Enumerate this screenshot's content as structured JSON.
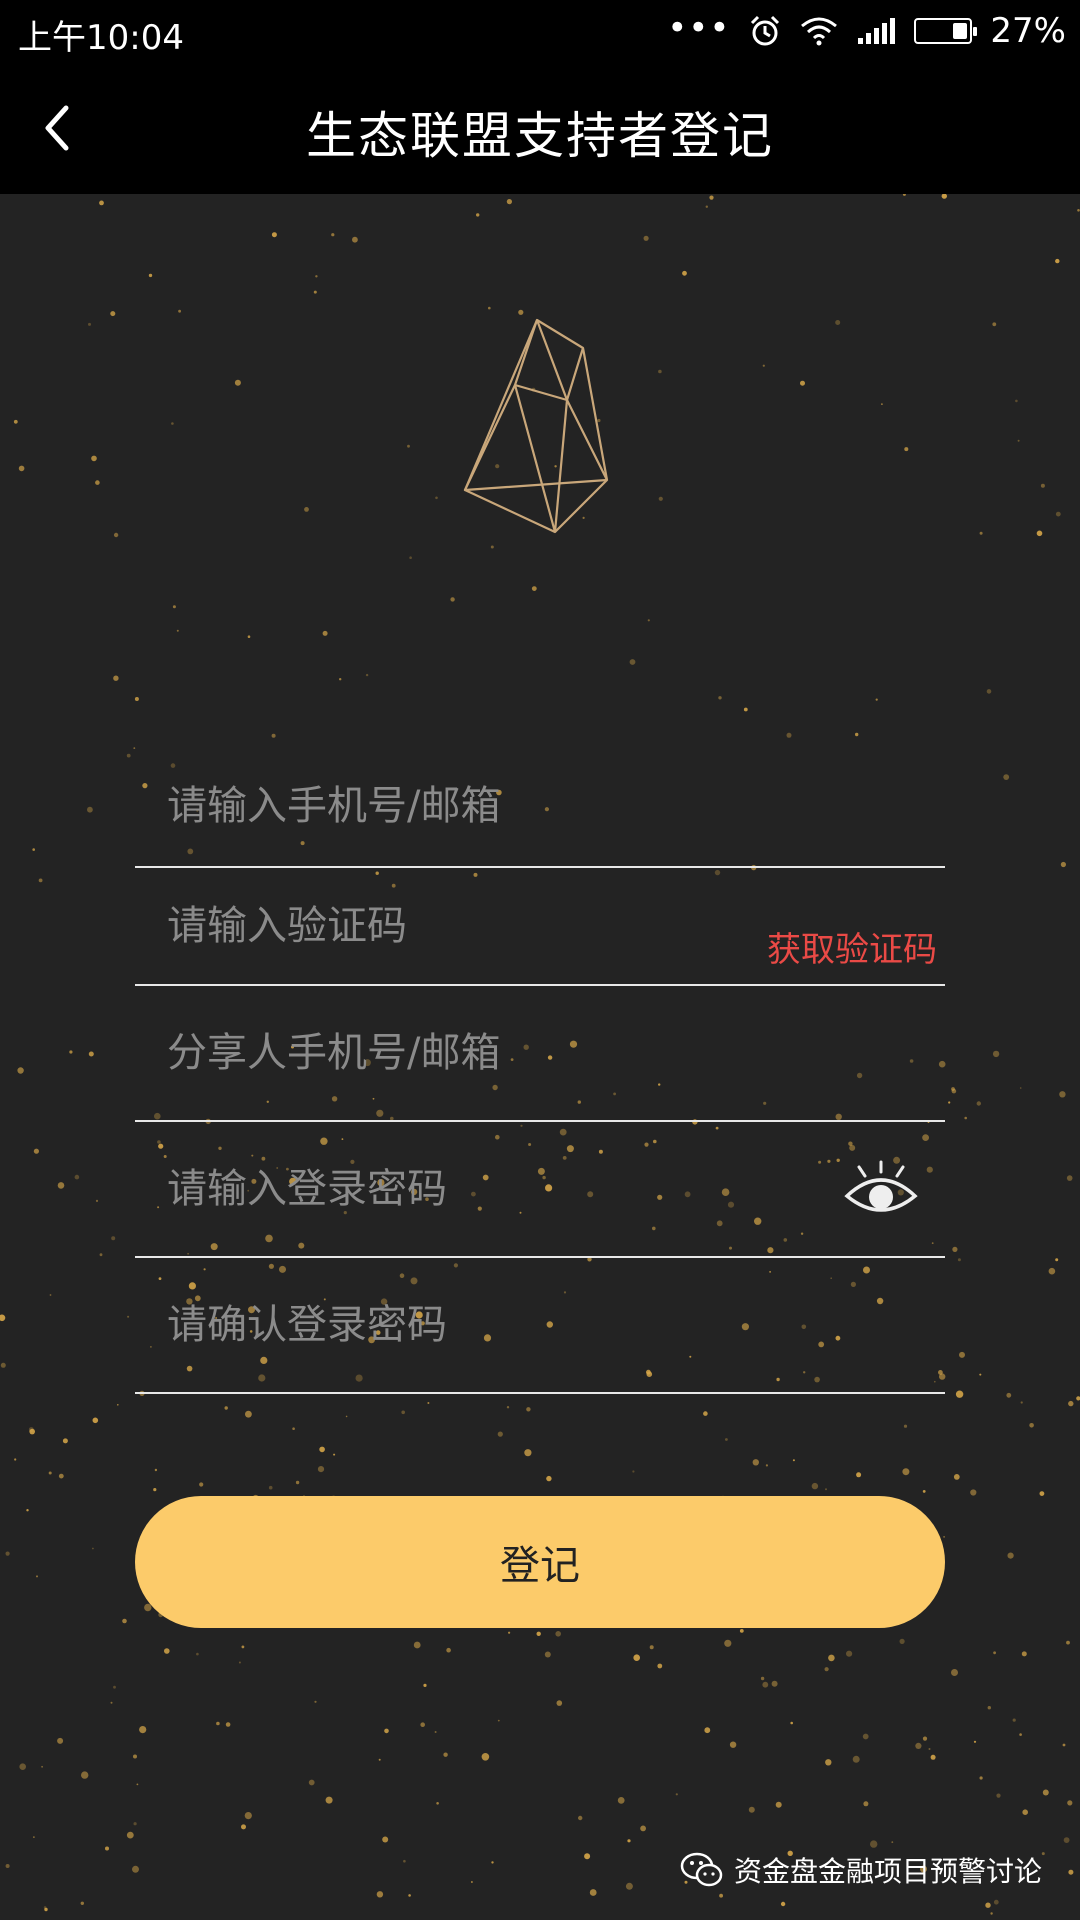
{
  "status_bar": {
    "time": "上午10:04",
    "dots": "•••",
    "battery_percent": "27%",
    "battery_level": 0.27,
    "icons": [
      "alarm-icon",
      "wifi-icon",
      "signal-icon",
      "battery-icon"
    ]
  },
  "header": {
    "title": "生态联盟支持者登记",
    "back_icon": "chevron-left-icon"
  },
  "logo": {
    "icon": "eos-crystal-logo-icon"
  },
  "form": {
    "phone_email_placeholder": "请输入手机号/邮箱",
    "code_placeholder": "请输入验证码",
    "get_code_label": "获取验证码",
    "referrer_placeholder": "分享人手机号/邮箱",
    "password_placeholder": "请输入登录密码",
    "confirm_password_placeholder": "请确认登录密码",
    "eye_icon": "eye-icon"
  },
  "submit": {
    "label": "登记"
  },
  "watermark": {
    "text": "资金盘金融项目预警讨论",
    "icon": "wechat-icon"
  },
  "colors": {
    "background": "#232323",
    "header": "#000000",
    "accent_button": "#fccb6a",
    "get_code_text": "#ea4a46",
    "particle_gold": "#d9a94a",
    "logo_stroke": "#c9a77a"
  }
}
